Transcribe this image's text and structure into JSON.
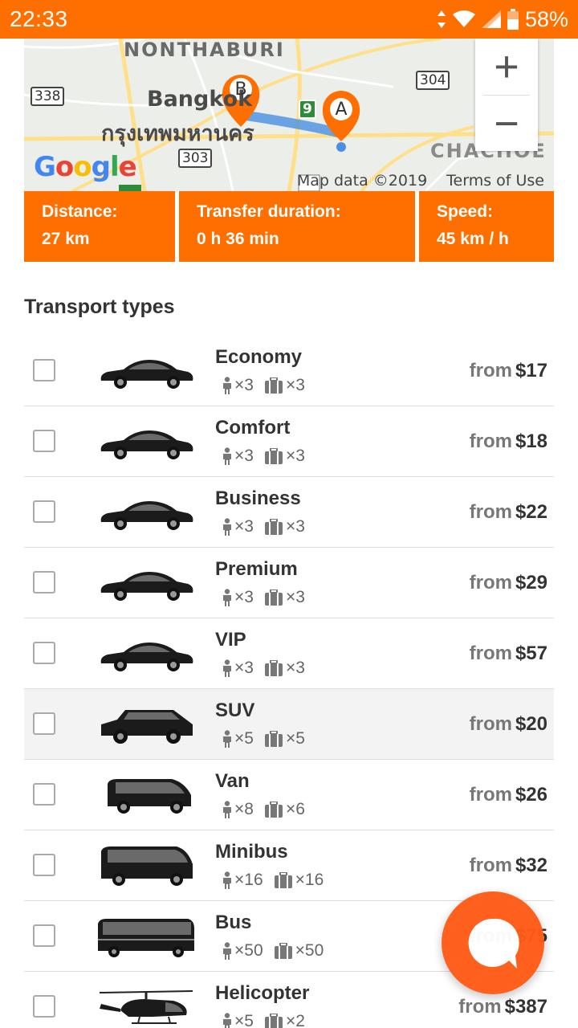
{
  "status_bar": {
    "time": "22:33",
    "battery": "58%"
  },
  "map": {
    "labels": {
      "nonthaburi": "NONTHABURI",
      "bangkok": "Bangkok",
      "bangkok_thai": "กรุงเทพมหานคร",
      "chachoengsao": "CHACHOE"
    },
    "road_shields": {
      "r338": "338",
      "r304": "304",
      "r303": "303",
      "r9": "9"
    },
    "markers": {
      "a": "A",
      "b": "B"
    },
    "google_logo": "Google",
    "attribution": "Map data ©2019",
    "terms": "Terms of Use",
    "zoom_in": "+",
    "zoom_out": "−"
  },
  "stats": {
    "distance_label": "Distance:",
    "distance_value": "27 km",
    "duration_label": "Transfer duration:",
    "duration_value": "0 h 36 min",
    "speed_label": "Speed:",
    "speed_value": "45 km / h"
  },
  "section_title": "Transport types",
  "price_prefix": "from",
  "transports": [
    {
      "name": "Economy",
      "pax": "×3",
      "bags": "×3",
      "price": "$17",
      "vehicle": "sedan"
    },
    {
      "name": "Comfort",
      "pax": "×3",
      "bags": "×3",
      "price": "$18",
      "vehicle": "sedan"
    },
    {
      "name": "Business",
      "pax": "×3",
      "bags": "×3",
      "price": "$22",
      "vehicle": "sedan"
    },
    {
      "name": "Premium",
      "pax": "×3",
      "bags": "×3",
      "price": "$29",
      "vehicle": "sedan"
    },
    {
      "name": "VIP",
      "pax": "×3",
      "bags": "×3",
      "price": "$57",
      "vehicle": "sedan"
    },
    {
      "name": "SUV",
      "pax": "×5",
      "bags": "×5",
      "price": "$20",
      "vehicle": "suv"
    },
    {
      "name": "Van",
      "pax": "×8",
      "bags": "×6",
      "price": "$26",
      "vehicle": "van"
    },
    {
      "name": "Minibus",
      "pax": "×16",
      "bags": "×16",
      "price": "$32",
      "vehicle": "minibus"
    },
    {
      "name": "Bus",
      "pax": "×50",
      "bags": "×50",
      "price": "$75",
      "vehicle": "bus"
    },
    {
      "name": "Helicopter",
      "pax": "×5",
      "bags": "×2",
      "price": "$387",
      "vehicle": "helicopter"
    }
  ],
  "colors": {
    "accent": "#ff6f00",
    "chat": "#ff5a14",
    "highlight_row": "#f3f3f3"
  }
}
